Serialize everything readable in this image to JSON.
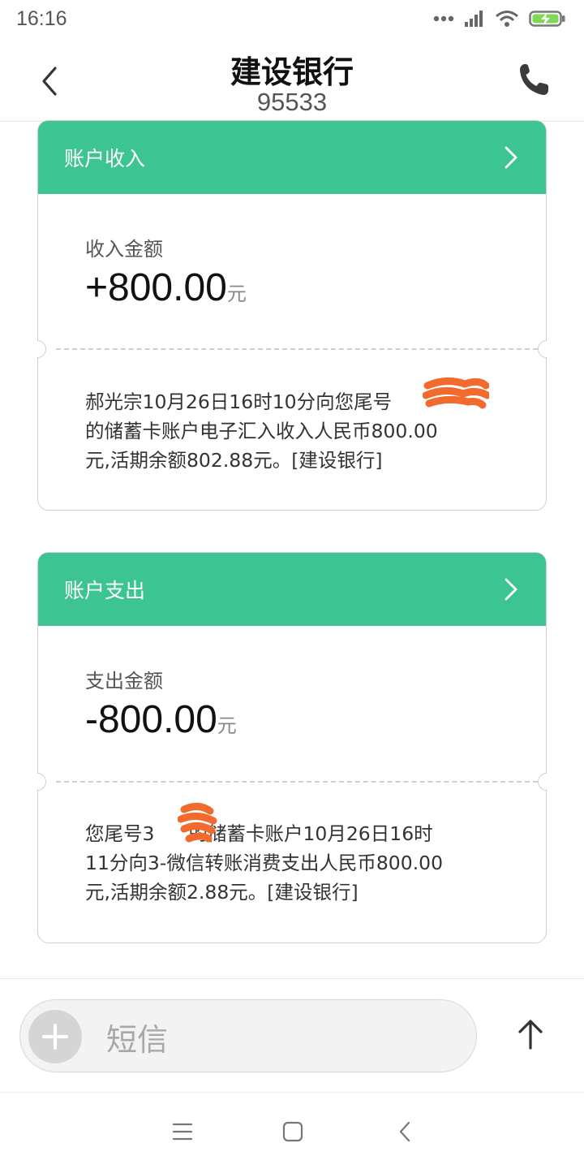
{
  "status_bar": {
    "time": "16:16"
  },
  "header": {
    "title": "建设银行",
    "number": "95533"
  },
  "cards": [
    {
      "head_label": "账户收入",
      "amount_label": "收入金额",
      "amount": "+800.00",
      "unit": "元",
      "message_lines": [
        "郝光宗10月26日16时10分向您尾号",
        "的储蓄卡账户电子汇入收入人民币800.00",
        "元,活期余额802.88元。[建设银行]"
      ]
    },
    {
      "head_label": "账户支出",
      "amount_label": "支出金额",
      "amount": "-800.00",
      "unit": "元",
      "message_lines": [
        "您尾号3",
        "的储蓄卡账户10月26日16时",
        "11分向3-微信转账消费支出人民币800.00",
        "元,活期余额2.88元。[建设银行]"
      ]
    }
  ],
  "composer": {
    "placeholder": "短信"
  },
  "colors": {
    "accent": "#3cc592",
    "redaction": "#f26a2e"
  },
  "icons": {
    "back": "chevron-left-icon",
    "call": "phone-icon",
    "card_chevron": "chevron-right-icon",
    "plus": "plus-icon",
    "send": "arrow-up-icon",
    "nav": [
      "menu-icon",
      "home-square-icon",
      "back-triangle-icon"
    ]
  }
}
